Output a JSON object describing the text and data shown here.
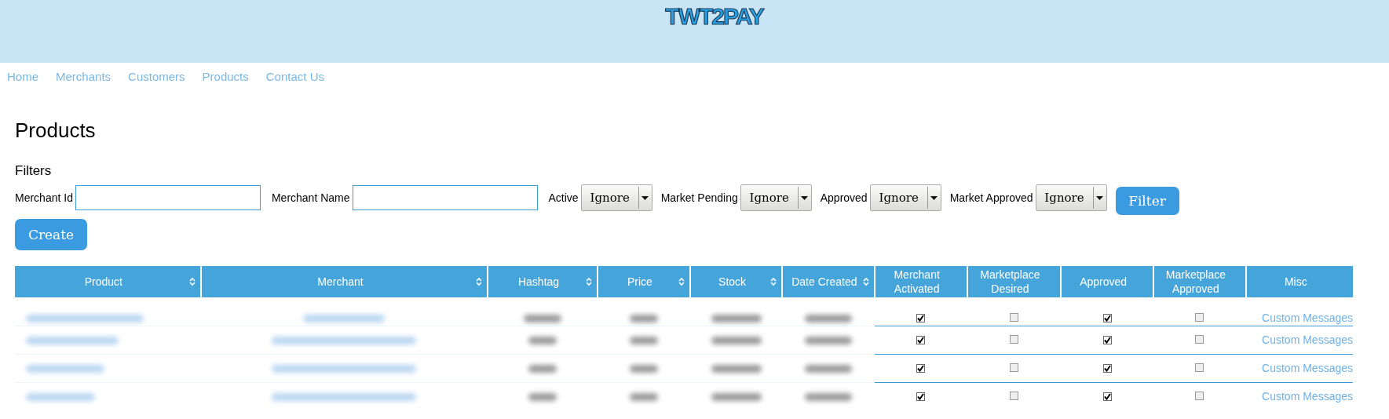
{
  "logo": "TWT2PAY",
  "nav": [
    {
      "label": "Home"
    },
    {
      "label": "Merchants"
    },
    {
      "label": "Customers"
    },
    {
      "label": "Products"
    },
    {
      "label": "Contact Us"
    }
  ],
  "title": "Products",
  "filters": {
    "heading": "Filters",
    "fields": [
      {
        "kind": "text",
        "label": "Merchant Id"
      },
      {
        "kind": "text",
        "label": "Merchant Name"
      },
      {
        "kind": "select",
        "label": "Active",
        "value": "Ignore"
      },
      {
        "kind": "select",
        "label": "Market Pending",
        "value": "Ignore"
      },
      {
        "kind": "select",
        "label": "Approved",
        "value": "Ignore"
      },
      {
        "kind": "select",
        "label": "Market Approved",
        "value": "Ignore"
      }
    ],
    "filter_button": "Filter",
    "create_button": "Create"
  },
  "table": {
    "columns": [
      {
        "label": "Product",
        "sortable": true
      },
      {
        "label": "Merchant",
        "sortable": true
      },
      {
        "label": "Hashtag",
        "sortable": true
      },
      {
        "label": "Price",
        "sortable": true
      },
      {
        "label": "Stock",
        "sortable": true
      },
      {
        "label": "Date Created",
        "sortable": true
      },
      {
        "label": "Merchant Activated",
        "sortable": false
      },
      {
        "label": "Marketplace Desired",
        "sortable": false
      },
      {
        "label": "Approved",
        "sortable": false
      },
      {
        "label": "Marketplace Approved",
        "sortable": false
      },
      {
        "label": "Misc",
        "sortable": false
      }
    ],
    "rows": [
      {
        "merchant_activated": true,
        "marketplace_desired": false,
        "approved": true,
        "marketplace_approved": false,
        "misc": "Custom Messages"
      },
      {
        "merchant_activated": true,
        "marketplace_desired": false,
        "approved": true,
        "marketplace_approved": false,
        "misc": "Custom Messages"
      },
      {
        "merchant_activated": true,
        "marketplace_desired": false,
        "approved": true,
        "marketplace_approved": false,
        "misc": "Custom Messages"
      },
      {
        "merchant_activated": true,
        "marketplace_desired": false,
        "approved": true,
        "marketplace_approved": false,
        "misc": "Custom Messages"
      }
    ]
  }
}
